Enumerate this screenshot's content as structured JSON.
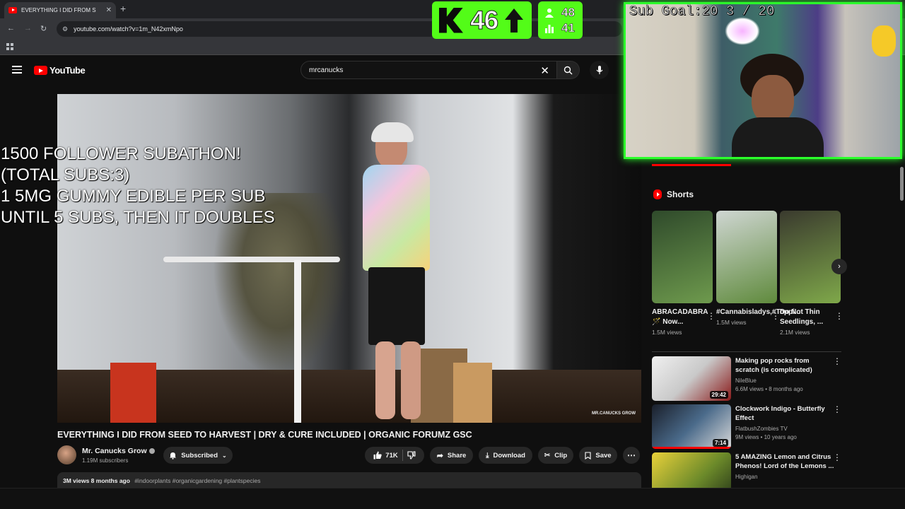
{
  "browser": {
    "tab_title": "EVERYTHING I DID FROM S",
    "url": "youtube.com/watch?v=1m_N42xmNpo"
  },
  "youtube": {
    "logo_text": "YouTube",
    "search_value": "mrcanucks"
  },
  "overlay": {
    "subathon_lines": [
      "1500 FOLLOWER SUBATHON!",
      "(TOTAL SUBS:3)",
      "1 5MG GUMMY EDIBLE PER SUB",
      "UNTIL 5 SUBS, THEN IT DOUBLES"
    ],
    "kick_count": "46",
    "stat_top": "48",
    "stat_bottom": "41",
    "sub_goal": "Sub Goal:20  3 / 20"
  },
  "video": {
    "watermark": "MR.CANUCKS GROW",
    "title": "EVERYTHING I DID FROM SEED TO HARVEST | DRY & CURE INCLUDED | ORGANIC FORUMZ GSC",
    "channel": "Mr. Canucks Grow",
    "subscribers": "1.19M subscribers",
    "subscribed_label": "Subscribed",
    "likes": "71K",
    "share_label": "Share",
    "download_label": "Download",
    "clip_label": "Clip",
    "save_label": "Save",
    "views_time": "3M views  8 months ago",
    "tags": "#indoorplants #organicgardening #plantspecies"
  },
  "sidebar": {
    "shorts_heading": "Shorts",
    "shorts": [
      {
        "title": "ABRACADABRA 🪄 Now...",
        "views": "1.5M views",
        "colors": [
          "#2f4a2b",
          "#6e9a4d"
        ]
      },
      {
        "title": "#Cannabisladys,#Toppi...",
        "views": "1.5M views",
        "colors": [
          "#cfd6d2",
          "#5f8a3c"
        ]
      },
      {
        "title": "Do Not Thin Seedlings, ...",
        "views": "2.1M views",
        "colors": [
          "#3a3a2e",
          "#7fa84a"
        ]
      }
    ],
    "recommended": [
      {
        "title": "Making pop rocks from scratch (is complicated)",
        "channel": "NileBlue",
        "meta": "6.6M views • 8 months ago",
        "duration": "29:42",
        "progress": 0
      },
      {
        "title": "Clockwork Indigo - Butterfly Effect",
        "channel": "FlatbushZombies TV",
        "meta": "9M views • 10 years ago",
        "duration": "7:14",
        "progress": 1
      },
      {
        "title": "5 AMAZING Lemon and Citrus Phenos! Lord of the Lemons ...",
        "channel": "Highigan",
        "meta": "",
        "duration": "",
        "progress": 0
      }
    ]
  }
}
